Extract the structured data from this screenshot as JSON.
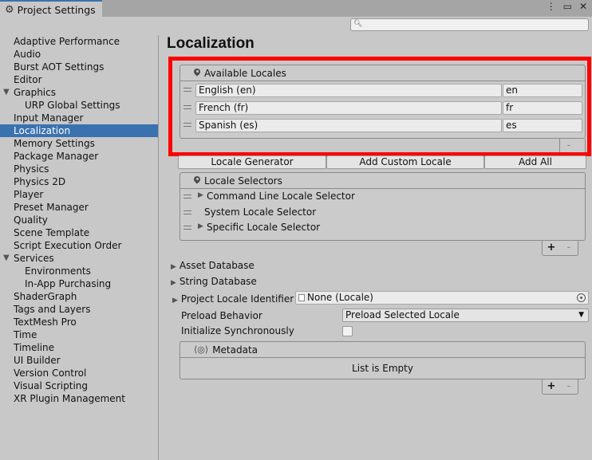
{
  "window": {
    "tab_title": "Project Settings",
    "icons": [
      "gear-icon",
      "more-options-icon",
      "maximize-icon",
      "close-icon"
    ],
    "accent_color": "#3a72b0"
  },
  "search": {
    "placeholder": ""
  },
  "sidebar": {
    "items": [
      {
        "label": "Adaptive Performance"
      },
      {
        "label": "Audio"
      },
      {
        "label": "Burst AOT Settings"
      },
      {
        "label": "Editor"
      },
      {
        "label": "Graphics",
        "expanded": true
      },
      {
        "label": "URP Global Settings",
        "indent": true
      },
      {
        "label": "Input Manager"
      },
      {
        "label": "Localization",
        "selected": true
      },
      {
        "label": "Memory Settings"
      },
      {
        "label": "Package Manager"
      },
      {
        "label": "Physics"
      },
      {
        "label": "Physics 2D"
      },
      {
        "label": "Player"
      },
      {
        "label": "Preset Manager"
      },
      {
        "label": "Quality"
      },
      {
        "label": "Scene Template"
      },
      {
        "label": "Script Execution Order"
      },
      {
        "label": "Services",
        "expanded": true
      },
      {
        "label": "Environments",
        "indent": true
      },
      {
        "label": "In-App Purchasing",
        "indent": true
      },
      {
        "label": "ShaderGraph"
      },
      {
        "label": "Tags and Layers"
      },
      {
        "label": "TextMesh Pro"
      },
      {
        "label": "Time"
      },
      {
        "label": "Timeline"
      },
      {
        "label": "UI Builder"
      },
      {
        "label": "Version Control"
      },
      {
        "label": "Visual Scripting"
      },
      {
        "label": "XR Plugin Management"
      }
    ]
  },
  "main": {
    "title": "Localization",
    "available_locales": {
      "header": "Available Locales",
      "rows": [
        {
          "name": "English (en)",
          "code": "en"
        },
        {
          "name": "French (fr)",
          "code": "fr"
        },
        {
          "name": "Spanish (es)",
          "code": "es"
        }
      ],
      "remove": "-"
    },
    "buttons": {
      "locale_generator": "Locale Generator",
      "add_custom_locale": "Add Custom Locale",
      "add_all": "Add All"
    },
    "locale_selectors": {
      "header": "Locale Selectors",
      "items": [
        {
          "label": "Command Line Locale Selector",
          "expandable": true
        },
        {
          "label": "System Locale Selector",
          "expandable": false
        },
        {
          "label": "Specific Locale Selector",
          "expandable": true
        }
      ],
      "add": "+",
      "remove": "-"
    },
    "asset_database": "Asset Database",
    "string_database": "String Database",
    "project_locale_identifier": {
      "label": "Project Locale Identifier",
      "value": "None (Locale)"
    },
    "preload_behavior": {
      "label": "Preload Behavior",
      "value": "Preload Selected Locale"
    },
    "initialize_synchronously": {
      "label": "Initialize Synchronously",
      "checked": false
    },
    "metadata": {
      "header": "Metadata",
      "empty_text": "List is Empty",
      "add": "+",
      "remove": "-"
    }
  }
}
